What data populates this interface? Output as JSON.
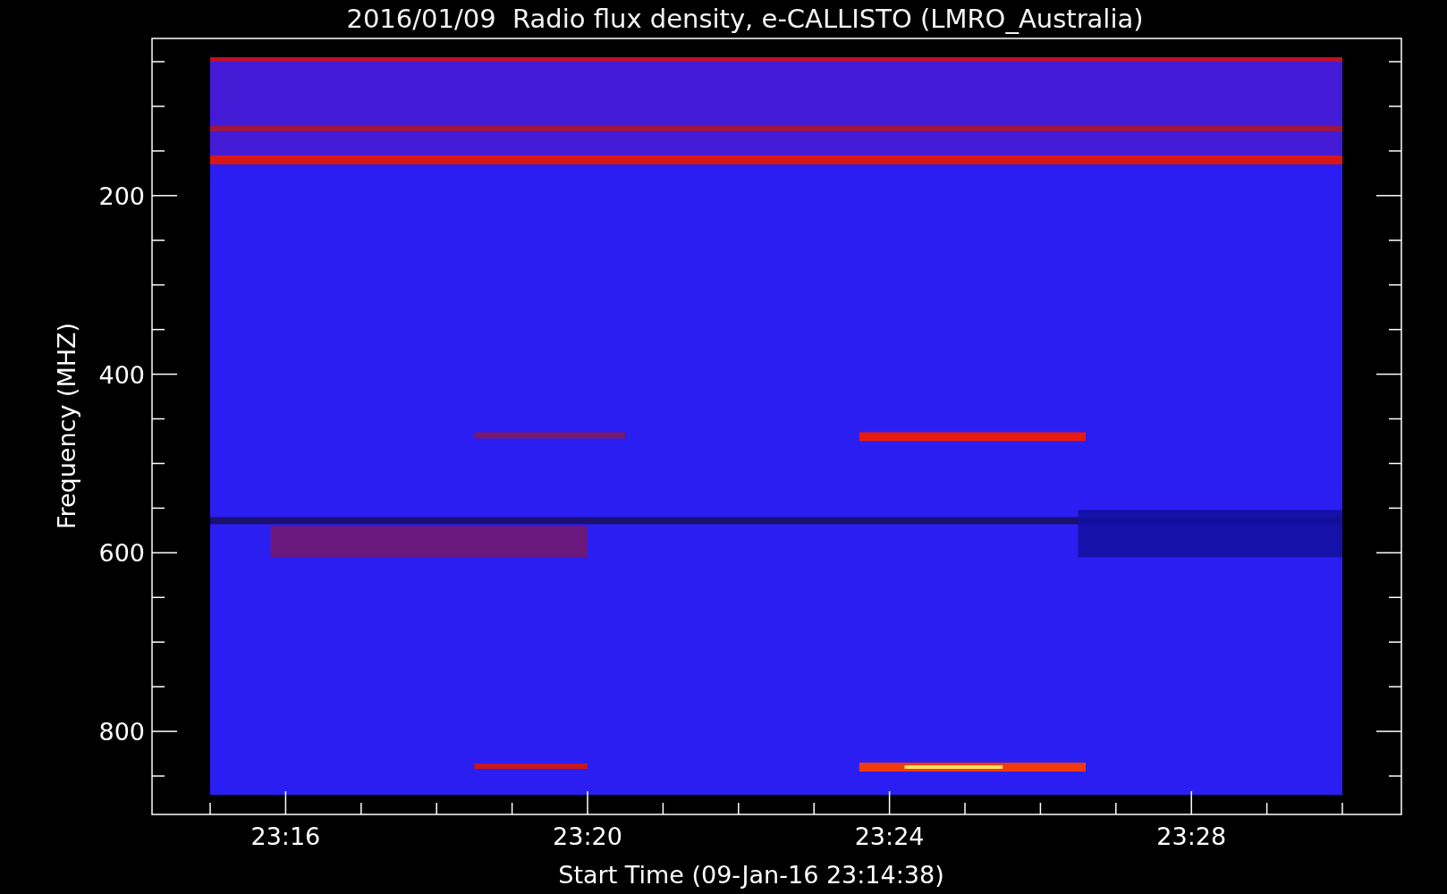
{
  "title": "2016/01/09  Radio flux density, e-CALLISTO (LMRO_Australia)",
  "plot": {
    "ylabel": "Frequency (MHZ)",
    "xlabel": "Start Time (09-Jan-16 23:14:38)",
    "yticks": [
      "200",
      "400",
      "600",
      "800"
    ],
    "xticks": [
      "23:16",
      "23:20",
      "23:24",
      "23:28"
    ]
  }
}
